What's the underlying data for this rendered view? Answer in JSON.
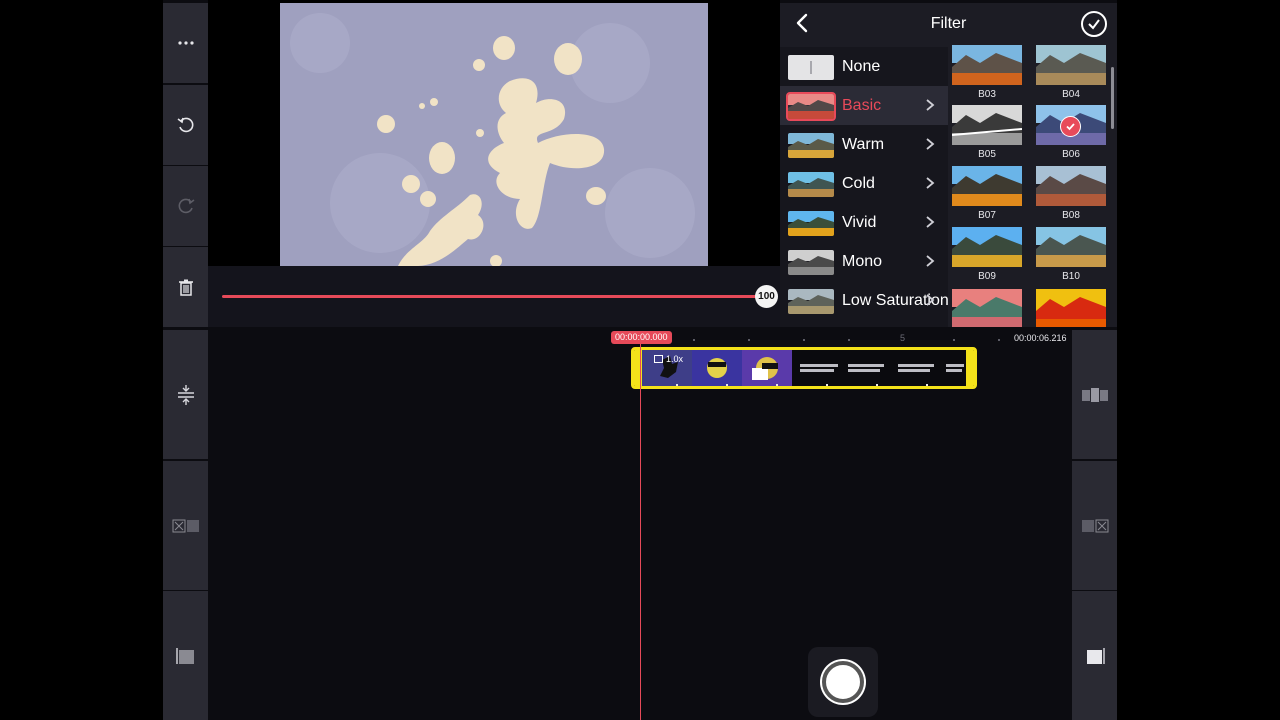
{
  "filter": {
    "title": "Filter",
    "categories": [
      {
        "label": "None"
      },
      {
        "label": "Basic"
      },
      {
        "label": "Warm"
      },
      {
        "label": "Cold"
      },
      {
        "label": "Vivid"
      },
      {
        "label": "Mono"
      },
      {
        "label": "Low Saturation"
      }
    ],
    "selected_category": "Basic",
    "grid": [
      {
        "label": "B03"
      },
      {
        "label": "B04"
      },
      {
        "label": "B05"
      },
      {
        "label": "B06"
      },
      {
        "label": "B07"
      },
      {
        "label": "B08"
      },
      {
        "label": "B09"
      },
      {
        "label": "B10"
      },
      {
        "label": ""
      },
      {
        "label": ""
      }
    ],
    "selected_filter": "B06"
  },
  "intensity": {
    "value": "100",
    "level": 1.0
  },
  "timeline": {
    "start_time": "00:00:00.000",
    "end_time": "00:00:06.216",
    "ruler_label": "5",
    "speed": "1.0x"
  },
  "colors": {
    "accent": "#e64a59",
    "clip_border": "#f4e21a",
    "panel": "#1c1c24",
    "toolbar": "#2a2a33"
  },
  "icons": {
    "more": "more-icon",
    "undo": "undo-icon",
    "redo": "redo-icon",
    "delete": "trash-icon",
    "back": "back-chevron-icon",
    "confirm": "checkmark-circle-icon"
  }
}
